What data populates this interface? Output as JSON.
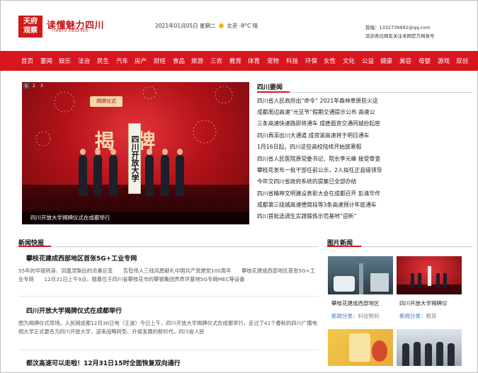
{
  "header": {
    "logo_mark_line1": "天府",
    "logo_mark_line2": "观察",
    "logo_title": "读懂魅力四川",
    "logo_subtitle": "TIANFU OBSEVER",
    "date": "2021年01月05日",
    "weekday": "星期二",
    "weather_icon": "sun-icon",
    "location_weather": "北京 -8°C 晴",
    "contact_email": "投稿：1332739992@qq.com",
    "contact_note": "欢迎各位网友关注本网官方网易号"
  },
  "nav": [
    "首页",
    "要闻",
    "娱乐",
    "法治",
    "民生",
    "汽车",
    "房产",
    "财经",
    "食品",
    "旅游",
    "三农",
    "教育",
    "体育",
    "宠物",
    "科技",
    "环保",
    "女性",
    "文化",
    "公益",
    "健康",
    "美容",
    "母婴",
    "游戏",
    "双创"
  ],
  "slider": {
    "pages": [
      "1",
      "2",
      "3"
    ],
    "banner_text": "揭牌仪式",
    "big_text": "揭牌",
    "board_text": "四川开放大学",
    "caption": "四川开放大学揭牌仪式在成都举行"
  },
  "sichuan_news": {
    "heading": "四川要闻",
    "items": [
      "四川省人民政府出“命令” 2021年森林草原防火这",
      "成都周边高速“元旦节”假期交通提示公布 高速公",
      "三条高速快速路即将通车 成德眉资交通同城抄起密",
      "四川再添出川大通道 成资渝高速将于明日通车",
      "1月16日起，四川这些高校陆续开始放寒假",
      "四川省人民医院原党委书记、院长李元峰 接受审查",
      "攀枝花发布一批干部任前公示，2人拟任正县级领导",
      "今年交四川省政府系统的提案已全部办结",
      "四川省精神文明建设表彰大会在成都召开 彭清华作",
      "成都第三绕城高速德简段等3条高速预计年底通车",
      "四川首批选调生实践锻炼示范基地”迎新”"
    ]
  },
  "quick_news": {
    "heading": "新闻快报",
    "items": [
      {
        "title": "攀枝花建成西部地区首张5G+工业专网",
        "body": "55年的华丽转身、凤凰涅槃后的沧桑巨变　　告慰伟人三线风愿献礼中国共产党建党100周年　　攀枝花建成西部地区首张5G+工业专网　　12月31日上午9点，随着位于四川省攀枝花市的攀钢集团弄弄环基地5G专网MEC等设备"
      },
      {
        "title": "四川开放大学揭牌仪式在成都举行",
        "body": "图为揭牌仪式现场。人民网成都12月30日电（王波）今日上午，四川开放大学揭牌仪式在成都举行，走过了41个春秋的四川广播电视大学正式更名为四川开放大学，迎来战略转型、升级发展的新时代。四川省人民"
      },
      {
        "title": "都汶高速可以走啦！12月31日15时全面恢复双向通行",
        "body": ""
      }
    ]
  },
  "picture_news": {
    "heading": "图片新闻",
    "items": [
      {
        "caption": "攀枝花建成西部地区",
        "category_label": "新闻分类：",
        "category": "科技数码"
      },
      {
        "caption": "四川开放大学揭牌仪",
        "category_label": "新闻分类：",
        "category": "教育"
      },
      {
        "caption": "",
        "category_label": "",
        "category": ""
      },
      {
        "caption": "",
        "category_label": "",
        "category": ""
      }
    ]
  },
  "colors": {
    "brand_red": "#d8161e",
    "link_blue": "#3a78c2"
  }
}
